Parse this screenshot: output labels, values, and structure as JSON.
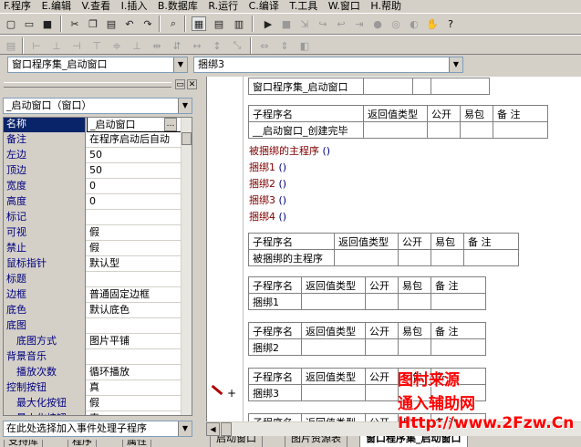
{
  "menu": [
    "F.程序",
    "E.编辑",
    "V.查看",
    "I.插入",
    "B.数据库",
    "R.运行",
    "C.编译",
    "T.工具",
    "W.窗口",
    "H.帮助"
  ],
  "combos": {
    "assembly": "窗口程序集_启动窗口",
    "subroutine": "捆绑3",
    "object": "_启动窗口（窗口）",
    "event": "在此处选择加入事件处理子程序"
  },
  "properties": [
    {
      "name": "名称",
      "value": "_启动窗口",
      "selected": true
    },
    {
      "name": "备注",
      "value": "在程序启动后自动"
    },
    {
      "name": "左边",
      "value": "50"
    },
    {
      "name": "顶边",
      "value": "50"
    },
    {
      "name": "宽度",
      "value": "0"
    },
    {
      "name": "高度",
      "value": "0"
    },
    {
      "name": "标记",
      "value": ""
    },
    {
      "name": "可视",
      "value": "假"
    },
    {
      "name": "禁止",
      "value": "假"
    },
    {
      "name": "鼠标指针",
      "value": "默认型"
    },
    {
      "name": "标题",
      "value": ""
    },
    {
      "name": "边框",
      "value": "普通固定边框"
    },
    {
      "name": "底色",
      "value": "默认底色"
    },
    {
      "name": "底图",
      "value": ""
    },
    {
      "name": "底图方式",
      "value": "图片平铺",
      "sub": true
    },
    {
      "name": "背景音乐",
      "value": ""
    },
    {
      "name": "播放次数",
      "value": "循环播放",
      "sub": true
    },
    {
      "name": "控制按钮",
      "value": "真"
    },
    {
      "name": "最大化按钮",
      "value": "假",
      "sub": true
    },
    {
      "name": "最小化按钮",
      "value": "真",
      "sub": true
    }
  ],
  "left_tabs": [
    "支持库",
    "程序",
    "属性"
  ],
  "editor": {
    "assembly_name": "窗口程序集_启动窗口",
    "headers_full": [
      "子程序名",
      "返回值类型",
      "公开",
      "易包",
      "备 注"
    ],
    "sub1_name": "__启动窗口_创建完毕",
    "bound_main_call": "被捆绑的主程序",
    "bind_calls": [
      "捆绑1",
      "捆绑2",
      "捆绑3",
      "捆绑4"
    ],
    "paren": "()",
    "sub2_name": "被捆绑的主程序",
    "sub3_name": "捆绑1",
    "sub4_name": "捆绑2",
    "sub5_name": "捆绑3",
    "gutter_plus": "+"
  },
  "right_tabs": [
    "启动窗口",
    "图片资源表",
    "窗口程序集_启动窗口"
  ],
  "watermark": {
    "line1": "图村来源",
    "line2": "通入辅助网",
    "line3": "Http://www.2Fzw.Cn"
  },
  "colors": {
    "chrome": "#d4d0c8",
    "selection": "#0a246a",
    "code_red": "#7f0000",
    "watermark_red": "#ff0000"
  }
}
